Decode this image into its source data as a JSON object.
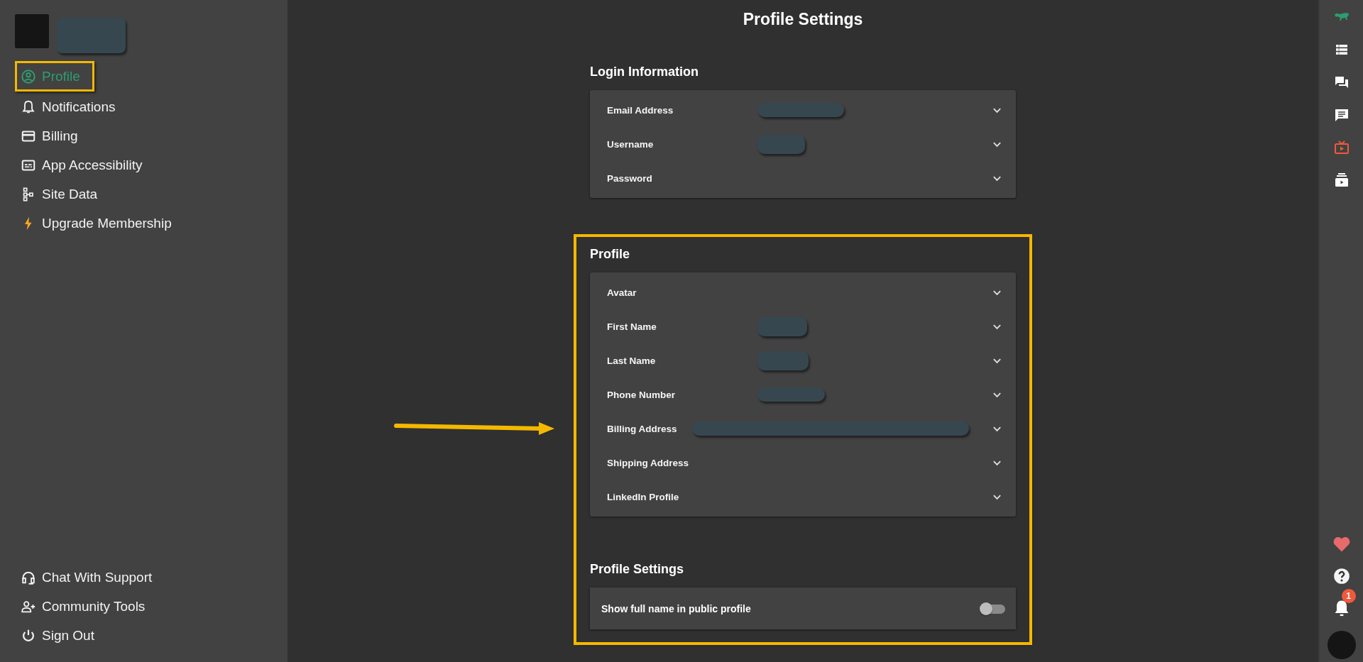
{
  "sidebar": {
    "user": {
      "avatar": true,
      "name_redacted": true
    },
    "items": [
      {
        "label": "Profile",
        "selected": true,
        "highlighted": true
      },
      {
        "label": "Notifications",
        "selected": false,
        "highlighted": false
      },
      {
        "label": "Billing",
        "selected": false,
        "highlighted": false
      },
      {
        "label": "App Accessibility",
        "selected": false,
        "highlighted": false
      },
      {
        "label": "Site Data",
        "selected": false,
        "highlighted": false
      },
      {
        "label": "Upgrade Membership",
        "selected": false,
        "highlighted": false
      }
    ],
    "footer_items": [
      {
        "label": "Chat With Support"
      },
      {
        "label": "Community Tools"
      },
      {
        "label": "Sign Out"
      }
    ]
  },
  "page": {
    "title": "Profile Settings"
  },
  "sections": [
    {
      "title": "Login Information",
      "highlighted": false,
      "rows": [
        {
          "label": "Email Address",
          "redacted": true,
          "expanded": false
        },
        {
          "label": "Username",
          "redacted": true,
          "expanded": false
        },
        {
          "label": "Password",
          "redacted": false,
          "expanded": false
        }
      ]
    },
    {
      "title": "Profile",
      "highlighted": true,
      "rows": [
        {
          "label": "Avatar",
          "redacted": false,
          "expanded": false
        },
        {
          "label": "First Name",
          "redacted": true,
          "expanded": false
        },
        {
          "label": "Last Name",
          "redacted": true,
          "expanded": false
        },
        {
          "label": "Phone Number",
          "redacted": true,
          "expanded": false
        },
        {
          "label": "Billing Address",
          "redacted": true,
          "expanded": false
        },
        {
          "label": "Shipping Address",
          "redacted": false,
          "expanded": false
        },
        {
          "label": "LinkedIn Profile",
          "redacted": false,
          "expanded": false
        }
      ],
      "settings_title": "Profile Settings",
      "toggles": [
        {
          "label": "Show full name in public profile",
          "on": false
        }
      ]
    }
  ],
  "annotation_arrow": true,
  "rail": {
    "notification_badge": "1"
  }
}
